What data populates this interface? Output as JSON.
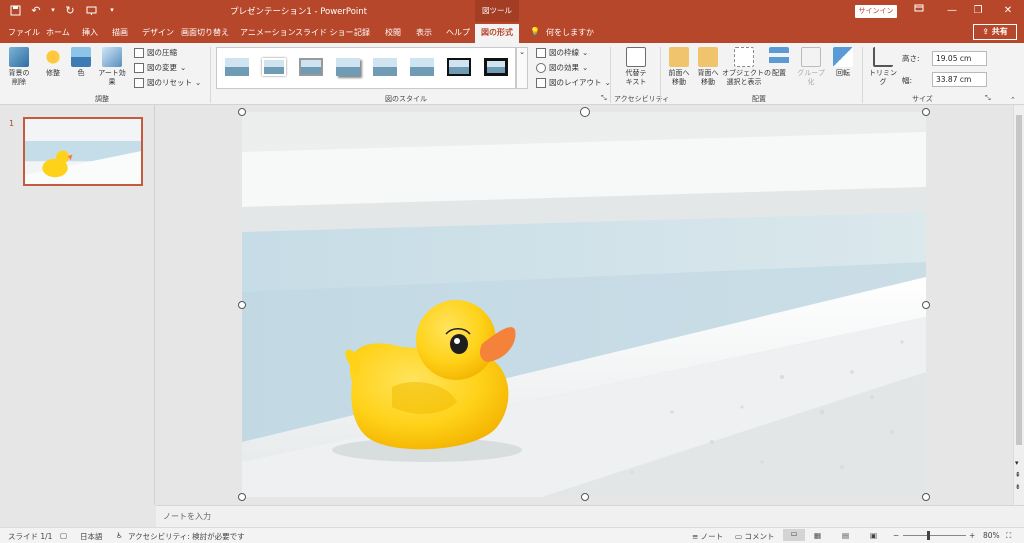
{
  "window": {
    "title": "プレゼンテーション1  -  PowerPoint",
    "context_tab": "図ツール",
    "signin": "サインイン",
    "share": "共有"
  },
  "tabs": [
    {
      "label": "ファイル"
    },
    {
      "label": "ホーム"
    },
    {
      "label": "挿入"
    },
    {
      "label": "描画"
    },
    {
      "label": "デザイン"
    },
    {
      "label": "画面切り替え"
    },
    {
      "label": "アニメーション"
    },
    {
      "label": "スライド ショー"
    },
    {
      "label": "記録"
    },
    {
      "label": "校閲"
    },
    {
      "label": "表示"
    },
    {
      "label": "ヘルプ"
    },
    {
      "label": "図の形式"
    }
  ],
  "tell_me": "何をしますか",
  "ribbon": {
    "adjust": {
      "label": "調整",
      "remove_bg": "背景の\n削除",
      "corrections": "修整",
      "color": "色",
      "artistic": "アート効果",
      "compress": "図の圧縮",
      "change": "図の変更",
      "reset": "図のリセット"
    },
    "styles": {
      "label": "図のスタイル",
      "border": "図の枠線",
      "effects": "図の効果",
      "layout": "図のレイアウト"
    },
    "accessibility": {
      "label": "アクセシビリティ",
      "alt_text": "代替テ\nキスト"
    },
    "arrange": {
      "label": "配置",
      "bring_forward": "前面へ\n移動",
      "send_backward": "背面へ\n移動",
      "selection_pane": "オブジェクトの\n選択と表示",
      "align": "配置",
      "group": "グループ化",
      "rotate": "回転"
    },
    "size": {
      "label": "サイズ",
      "crop": "トリミング",
      "height_label": "高さ:",
      "height_value": "19.05 cm",
      "width_label": "幅:",
      "width_value": "33.87 cm"
    }
  },
  "thumbnail": {
    "slide_number": "1"
  },
  "notes_placeholder": "ノートを入力",
  "status": {
    "slide": "スライド 1/1",
    "language": "日本語",
    "accessibility": "アクセシビリティ: 検討が必要です",
    "notes": "ノート",
    "comments": "コメント",
    "zoom": "80%"
  },
  "colors": {
    "accent": "#b7472a",
    "duck": "#ffd21a",
    "beak": "#f5823a"
  }
}
